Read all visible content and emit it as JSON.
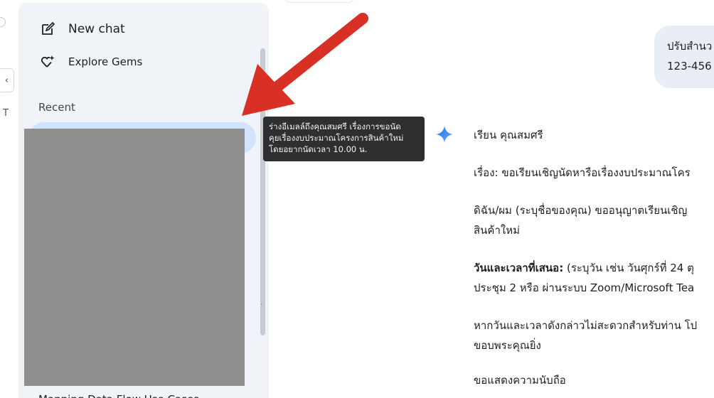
{
  "sidebar": {
    "new_chat_label": "New chat",
    "explore_gems_label": "Explore Gems",
    "recent_label": "Recent",
    "cut_off_item": "Mapping Data Flow Use Cases"
  },
  "left_strip": {
    "letter": "T",
    "tab_glyph": "‹"
  },
  "tooltip": {
    "line1": "ร่างอีเมลล์ถึงคุณสมศรี เรื่องการขอนัด",
    "line2": "คุยเรื่องงบประมาณโครงการสินค้าใหม่",
    "line3": "โดยอยากนัดเวลา 10.00 น."
  },
  "user_message": {
    "line1": "ปรับสำนว",
    "line2": "123-456"
  },
  "response": {
    "greeting": "เรียน คุณสมศรี",
    "subject": "เรื่อง: ขอเรียนเชิญนัดหารือเรื่องงบประมาณโคร",
    "intro_line1": "ดิฉัน/ผม (ระบุชื่อของคุณ) ขออนุญาตเรียนเชิญ",
    "intro_line2": "สินค้าใหม่",
    "date_label": "วันและเวลาที่เสนอ:",
    "date_text": " (ระบุวัน เช่น วันศุกร์ที่ 24 ตุ",
    "date_line2": "ประชุม 2 หรือ ผ่านระบบ Zoom/Microsoft Tea",
    "alt_line1": "หากวันและเวลาดังกล่าวไม่สะดวกสำหรับท่าน โป",
    "alt_line2": "ขอบพระคุณยิ่ง",
    "closing": "ขอแสดงความนับถือ"
  },
  "colors": {
    "sidebar_bg": "#f0f4f9",
    "active_pill": "#d3e3fd",
    "user_bubble": "#e9eef6",
    "tooltip_bg": "#2d2f31",
    "annotation_arrow": "#d93025",
    "gem_star": "#4285f4"
  },
  "icons": [
    "edit-square-icon",
    "gems-heart-sparkle-icon",
    "gemini-sparkle-icon",
    "annotation-arrow"
  ]
}
